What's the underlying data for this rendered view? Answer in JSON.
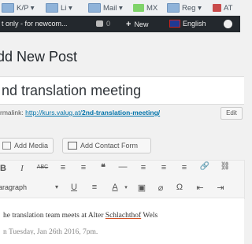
{
  "browser": {
    "bookmarks": [
      {
        "label": "K/P ▾",
        "icon": "folder-icon"
      },
      {
        "label": "Li ▾",
        "icon": "folder-icon"
      },
      {
        "label": "Mail ▾",
        "icon": "folder-icon"
      },
      {
        "label": "MX",
        "icon": "mx-icon"
      },
      {
        "label": "Reg ▾",
        "icon": "folder-icon"
      },
      {
        "label": "AT",
        "icon": "at-icon"
      }
    ]
  },
  "admin_bar": {
    "site_name": "t only - for newcom...",
    "comments_count": "0",
    "new_label": "New",
    "language_label": "English"
  },
  "page": {
    "heading": "dd New Post"
  },
  "post": {
    "title": "nd translation meeting",
    "permalink_label": "rmalink:",
    "permalink_base": "http://kurs.valug.at/",
    "permalink_slug": "2nd-translation-meeting/",
    "edit_label": "Edit"
  },
  "media_buttons": {
    "add_media": "Add Media",
    "add_contact_form": "Add Contact Form"
  },
  "editor": {
    "format_select": "aragraph",
    "toolbar_row1": [
      "B",
      "I",
      "ABC",
      "≡",
      "≡",
      "❝",
      "—",
      "≡",
      "≡",
      "≡",
      "🔗",
      "⛓"
    ],
    "toolbar_row2": [
      "▾",
      "U",
      "≡",
      "A",
      "▾",
      "▣",
      "⌀",
      "Ω",
      "⇤",
      "⇥"
    ],
    "content_line1_pre": "he translation team meets at Alter ",
    "content_line1_link": "Schlachthof",
    "content_line1_post": " Wels",
    "content_line2": "n Tuesday, Jan 26th 2016, 7pm."
  }
}
